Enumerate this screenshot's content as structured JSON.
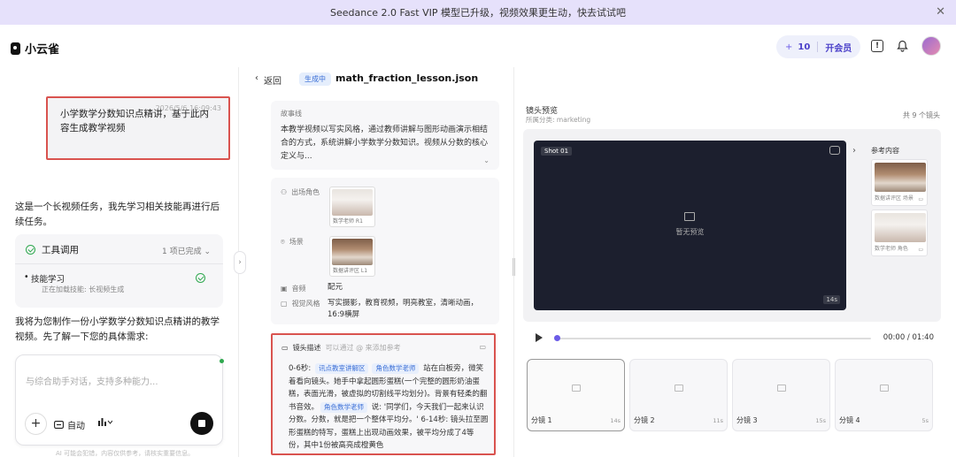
{
  "banner": {
    "text": "Seedance 2.0 Fast VIP 模型已升级，视频效果更生动，快去试试吧",
    "close_icon": "✕"
  },
  "header": {
    "app_name": "小云雀",
    "credits_prefix": "+",
    "credits": "10",
    "vip_label": "开会员",
    "feedback_icon": "!",
    "bell_icon": "🔔"
  },
  "chat": {
    "user_message": "小学数学分数知识点精讲，基于此内容生成教学视频",
    "user_time": "2026/5/6 16:09:43",
    "assistant_intro": "这是一个长视频任务，我先学习相关技能再进行后续任务。",
    "tool_call": {
      "title": "工具调用",
      "status": "1 项已完成",
      "item_title": "技能学习",
      "item_sub": "正在加载技能: 长视频生成"
    },
    "assistant_followup": "我将为您制作一份小学数学分数知识点精讲的教学视频。先了解一下您的具体需求:",
    "input_placeholder": "与综合助手对话，支持多种能力...",
    "auto_label": "自动",
    "disclaimer": "AI 可能会犯错，内容仅供参考，请核实重要信息。"
  },
  "project": {
    "back_label": "返回",
    "status_badge": "生成中",
    "file_name": "math_fraction_lesson.json"
  },
  "storyline": {
    "label": "故事线",
    "text": "本教学视频以写实风格，通过教师讲解与图形动画演示相结合的方式，系统讲解小学数学分数知识。视频从分数的核心定义与..."
  },
  "meta": {
    "roles_label": "出场角色",
    "role_caption": "数学老师 R1",
    "scene_label": "场景",
    "scene_caption": "数据讲评区 L1",
    "voice_label": "音频",
    "voice_value": "配元",
    "style_label": "视觉风格",
    "style_value": "写实摄影，教育视频，明亮教室，清晰动画，16:9横屏"
  },
  "shot_desc": {
    "label": "镜头描述",
    "hint": "可以通过 @ 来添加参考",
    "prefix": "0-6秒: ",
    "tag1": "讯点教室讲解区",
    "tag2": "角色数学老师",
    "mid1": " 站在白板旁，微笑着看向镜头。她手中拿起圆形蛋糕(一个完整的圆形奶油蛋糕，表面光滑，被虚拟的切割线平均划分)。背景有轻柔的翻书音效。",
    "tag3": "角色数学老师",
    "mid2": " 说: '同学们，今天我们一起来认识分数。分数，就是把一个整体平均分。' 6-14秒: 镜头拉至圆形蛋糕的特写，蛋糕上出现动画效果，被平均分成了4等份，其中1份被高亮成橙黄色"
  },
  "preview": {
    "title": "镜头预览",
    "subtitle": "所属分类: marketing",
    "count": "共 9 个镜头",
    "shot_label": "Shot 01",
    "no_preview": "暂无预览",
    "duration": "14s",
    "ref_label": "参考内容",
    "ref1_caption": "数据讲评区 场景",
    "ref2_caption": "数学老师 角色",
    "time": "00:00 / 01:40",
    "progress": 0
  },
  "shots": [
    {
      "name": "分镜 1",
      "dur": "14s"
    },
    {
      "name": "分镜 2",
      "dur": "11s"
    },
    {
      "name": "分镜 3",
      "dur": "15s"
    },
    {
      "name": "分镜 4",
      "dur": "5s"
    }
  ],
  "colors": {
    "accent": "#6c5ce7",
    "highlight_border": "#d9534f",
    "banner_bg": "#e6e1fb"
  }
}
